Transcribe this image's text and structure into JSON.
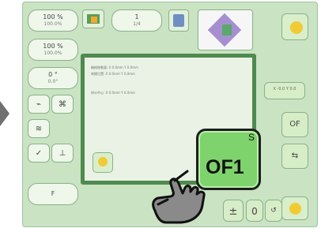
{
  "screen": {
    "background": "#c9e3c3",
    "accent": "#4f8a4f",
    "highlight_button": "#7ed36d"
  },
  "left_panel": {
    "zoom_1": {
      "value": "100 %",
      "sub": "100.0%"
    },
    "zoom_2": {
      "value": "100 %",
      "sub": "100.0%"
    },
    "angle": {
      "value": "0 °",
      "sub": "0.0°"
    },
    "speed": {
      "value": "F",
      "sub": ""
    }
  },
  "top_panel": {
    "thread_count": {
      "value": "1",
      "sub": "1/4"
    }
  },
  "bottom_panel": {
    "plus_minus": "±",
    "zero": "0"
  },
  "right_panel": {
    "mini_readout": "X -0.0 Y 0.0",
    "of_label": "OF"
  },
  "dialog": {
    "lines": [
      "機械移動量: X 0.0mm  Y 0.0mm",
      "刺繍位置: X 0.0mm  Y 0.0mm",
      "枠の中心: X 0.0mm  Y 0.0mm"
    ]
  },
  "highlight": {
    "label": "OF1",
    "tag": "S"
  },
  "icons": [
    "arrow-icon",
    "jump-icon",
    "stitch-icon",
    "needle-icon",
    "frame-icon",
    "hand-pointer-icon",
    "moon-icon"
  ]
}
